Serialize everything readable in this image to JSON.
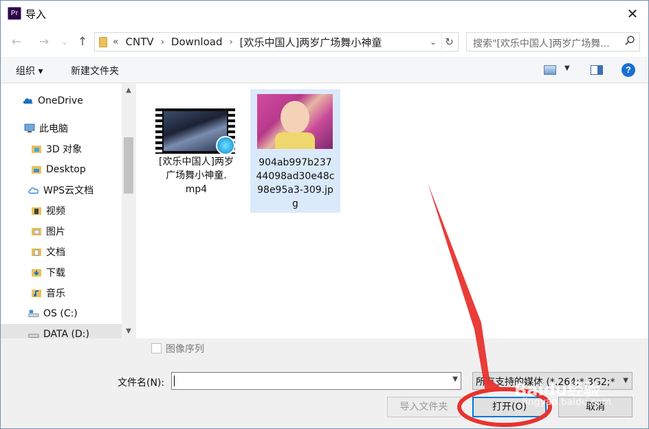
{
  "window": {
    "title": "导入",
    "app_icon_text": "Pr",
    "close_glyph": "✕"
  },
  "address": {
    "back_glyph": "←",
    "forward_glyph": "→",
    "recent_glyph": "⌄",
    "up_glyph": "↑",
    "overflow_glyph": "«",
    "crumbs": [
      "CNTV",
      "Download",
      "[欢乐中国人]两岁广场舞小神童"
    ],
    "separator": "›",
    "dropdown_glyph": "⌄",
    "refresh_glyph": "↻"
  },
  "search": {
    "placeholder": "搜索\"[欢乐中国人]两岁广场舞...",
    "icon": "search-icon"
  },
  "toolbar": {
    "organize_label": "组织 ▾",
    "new_folder_label": "新建文件夹",
    "help_label": "?"
  },
  "nav": {
    "items": [
      {
        "label": "OneDrive",
        "icon": "cloud-icon"
      },
      {
        "label": "此电脑",
        "icon": "computer-icon"
      },
      {
        "label": "3D 对象",
        "icon": "folder-icon"
      },
      {
        "label": "Desktop",
        "icon": "folder-icon"
      },
      {
        "label": "WPS云文档",
        "icon": "cloud-icon"
      },
      {
        "label": "视频",
        "icon": "video-folder-icon"
      },
      {
        "label": "图片",
        "icon": "pictures-folder-icon"
      },
      {
        "label": "文档",
        "icon": "documents-folder-icon"
      },
      {
        "label": "下载",
        "icon": "downloads-folder-icon"
      },
      {
        "label": "音乐",
        "icon": "music-folder-icon"
      },
      {
        "label": "OS (C:)",
        "icon": "drive-icon"
      },
      {
        "label": "DATA (D:)",
        "icon": "drive-icon"
      }
    ]
  },
  "files": [
    {
      "name_line1": "[欢乐中国人]两岁",
      "name_line2": "广场舞小神童.",
      "name_line3": "mp4",
      "name_line4": "",
      "type": "video"
    },
    {
      "name_line1": "904ab997b237",
      "name_line2": "44098ad30e48c",
      "name_line3": "98e95a3-309.jp",
      "name_line4": "g",
      "type": "image"
    }
  ],
  "bottom": {
    "image_sequence_label": "图像序列",
    "filename_label": "文件名(N):",
    "filename_value": "",
    "filetype_value": "所有支持的媒体 (*.264;*.3G2;*",
    "import_folder_label": "导入文件夹",
    "open_label": "打开(O)",
    "cancel_label": "取消"
  },
  "annotation": {
    "color": "#e8332e",
    "watermark": "Baidu经验",
    "watermark_sub": "jingyan.baidu.com"
  }
}
